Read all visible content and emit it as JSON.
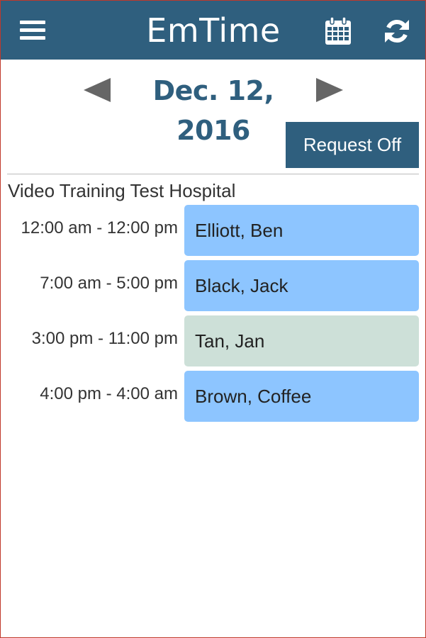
{
  "header": {
    "app_title": "EmTime",
    "background_color": "#2f5f7e",
    "menu_icon": "hamburger-menu-icon",
    "calendar_icon": "calendar-icon",
    "refresh_icon": "refresh-icon"
  },
  "date_nav": {
    "date_label": "Dec. 12, 2016",
    "prev_icon": "triangle-left-icon",
    "next_icon": "triangle-right-icon"
  },
  "actions": {
    "request_off_label": "Request Off"
  },
  "facility": {
    "name": "Video Training Test Hospital"
  },
  "shifts": [
    {
      "time": "12:00 am - 12:00 pm",
      "employee": "Elliott, Ben",
      "color": "#8dc5ff"
    },
    {
      "time": "7:00 am - 5:00 pm",
      "employee": "Black, Jack",
      "color": "#8dc5ff"
    },
    {
      "time": "3:00 pm - 11:00 pm",
      "employee": "Tan, Jan",
      "color": "#cde0d8"
    },
    {
      "time": "4:00 pm - 4:00 am",
      "employee": "Brown, Coffee",
      "color": "#8dc5ff"
    }
  ]
}
